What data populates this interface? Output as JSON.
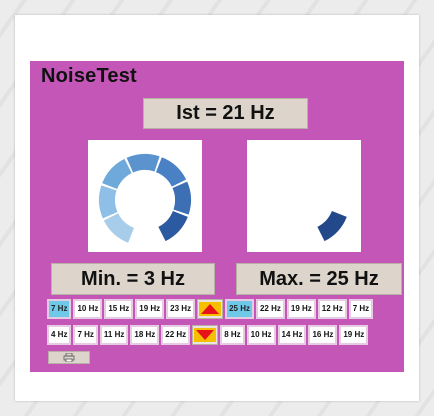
{
  "app": {
    "title": "NoiseTest"
  },
  "current": {
    "label": "Ist = 21 Hz"
  },
  "dials": {
    "left": {
      "segments_lit": 7,
      "segments_total": 8
    },
    "right": {
      "segments_lit": 1,
      "segments_total": 8
    }
  },
  "range": {
    "min_label": "Min. = 3 Hz",
    "max_label": "Max. = 25 Hz"
  },
  "history": {
    "row1": [
      "7 Hz",
      "10 Hz",
      "15 Hz",
      "19 Hz",
      "23 Hz"
    ],
    "row1_right": [
      "25 Hz",
      "22 Hz",
      "19 Hz",
      "12 Hz",
      "7 Hz"
    ],
    "row2": [
      "4 Hz",
      "7 Hz",
      "11 Hz",
      "18 Hz",
      "22 Hz"
    ],
    "row2_right": [
      "8 Hz",
      "10 Hz",
      "14 Hz",
      "16 Hz",
      "19 Hz"
    ]
  },
  "icons": {
    "up": "arrow-up-icon",
    "down": "arrow-down-icon",
    "print": "print-icon"
  },
  "colors": {
    "panel": "#c356b7",
    "box": "#ddd5cc",
    "highlight": "#6ec8e8",
    "arrow_fill": "#e8121a",
    "arrow_bg": "#f6c000"
  }
}
